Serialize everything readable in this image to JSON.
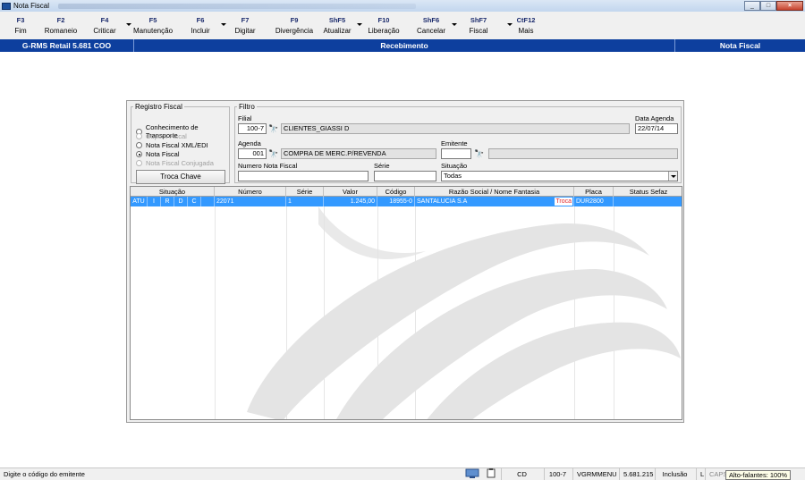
{
  "window": {
    "title": "Nota Fiscal"
  },
  "fkeys": [
    {
      "key": "F3",
      "label": "Fim",
      "w": 38,
      "arrow": false
    },
    {
      "key": "F2",
      "label": "Romaneio",
      "w": 52,
      "arrow": false
    },
    {
      "key": "F4",
      "label": "Criticar",
      "w": 46,
      "arrow": true
    },
    {
      "key": "F5",
      "label": "Manutenção",
      "w": 62,
      "arrow": false
    },
    {
      "key": "F6",
      "label": "Incluir",
      "w": 44,
      "arrow": true
    },
    {
      "key": "F7",
      "label": "Digitar",
      "w": 56,
      "arrow": false
    },
    {
      "key": "F9",
      "label": "Divergência",
      "w": 54,
      "arrow": false
    },
    {
      "key": "ShF5",
      "label": "Atualizar",
      "w": 42,
      "arrow": true
    },
    {
      "key": "F10",
      "label": "Liberação",
      "w": 62,
      "arrow": false
    },
    {
      "key": "ShF6",
      "label": "Cancelar",
      "w": 44,
      "arrow": true
    },
    {
      "key": "ShF7",
      "label": "Fiscal",
      "w": 62,
      "arrow": true
    },
    {
      "key": "CtF12",
      "label": "Mais",
      "w": 44,
      "arrow": false
    }
  ],
  "header": {
    "left": "G-RMS Retail 5.681 COO",
    "center": "Recebimento",
    "right": "Nota Fiscal"
  },
  "registro": {
    "legend": "Registro Fiscal",
    "options": [
      {
        "label": "Conhecimento de Transporte",
        "checked": false,
        "disabled": false
      },
      {
        "label": "Cupom Fiscal",
        "checked": false,
        "disabled": true
      },
      {
        "label": "Nota Fiscal XML/EDI",
        "checked": false,
        "disabled": false
      },
      {
        "label": "Nota Fiscal",
        "checked": true,
        "disabled": false
      },
      {
        "label": "Nota Fiscal Conjugada",
        "checked": false,
        "disabled": true
      }
    ],
    "troca_chave": "Troca Chave"
  },
  "filtro": {
    "legend": "Filtro",
    "filial_label": "Filial",
    "filial_code": "100-7",
    "filial_name": "CLIENTES_GIASSI D",
    "data_agenda_label": "Data Agenda",
    "data_agenda": "22/07/14",
    "agenda_label": "Agenda",
    "agenda_code": "001",
    "agenda_desc": "COMPRA DE MERC.P/REVENDA",
    "emitente_label": "Emitente",
    "emitente_code": "",
    "emitente_name": "",
    "numero_label": "Numero Nota Fiscal",
    "numero": "",
    "serie_label": "Série",
    "serie": "",
    "situacao_label": "Situação",
    "situacao": "Todas"
  },
  "grid": {
    "headers": {
      "situacao": "Situação",
      "numero": "Número",
      "serie": "Série",
      "valor": "Valor",
      "codigo": "Código",
      "razao": "Razão Social / Nome Fantasia",
      "placa": "Placa Veículo",
      "status": "Status Sefaz"
    },
    "rows": [
      {
        "flags": [
          "ATU",
          "I",
          "R",
          "D",
          "C",
          ""
        ],
        "numero": "22071",
        "serie": "1",
        "valor": "1.245,00",
        "codigo": "18955-0",
        "razao": "SANTALUCIA S.A",
        "badge": "Troca",
        "placa": "DUR2800",
        "status": ""
      }
    ]
  },
  "status": {
    "message": "Digite o código do emitente",
    "cd": "CD",
    "filial": "100-7",
    "menu": "VGRMMENU",
    "version": "5.681.215",
    "mode": "Inclusão",
    "l": "L",
    "caps": "CAPS",
    "tooltip": "Alto-falantes: 100%"
  },
  "colors": {
    "header_bg": "#0d3f9e",
    "selection": "#3399ff",
    "badge_text": "#e0282b"
  }
}
